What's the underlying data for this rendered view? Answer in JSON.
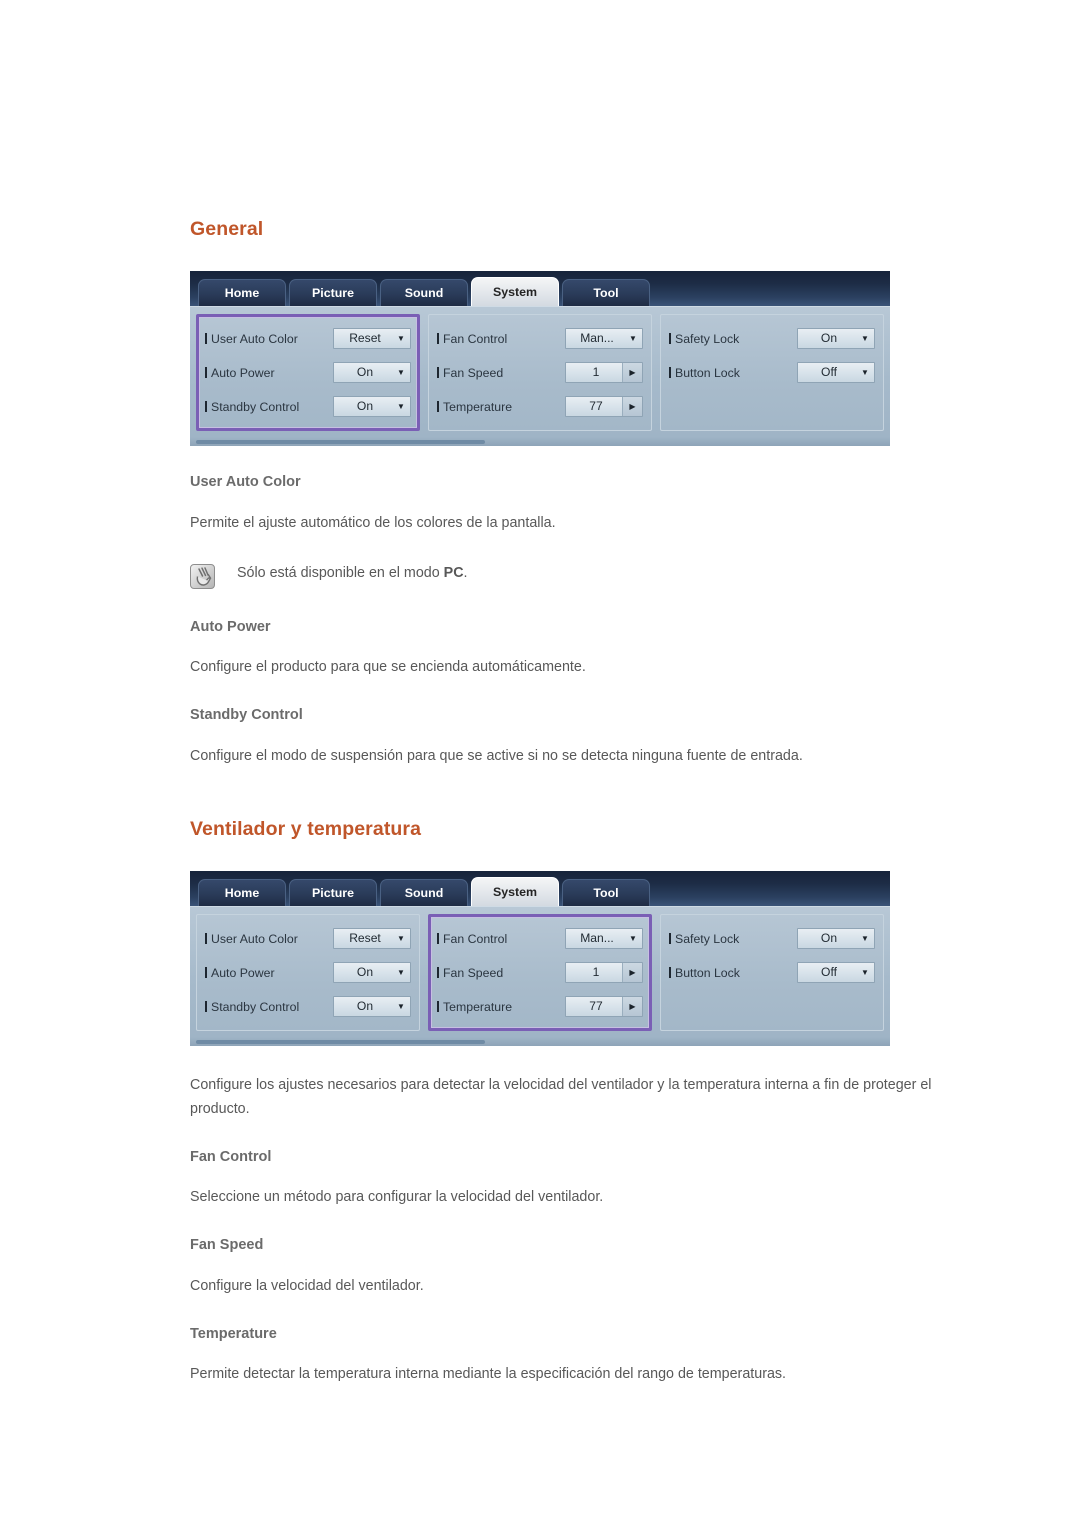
{
  "sections": [
    {
      "heading": "General",
      "osd": {
        "tabs": [
          "Home",
          "Picture",
          "Sound",
          "System",
          "Tool"
        ],
        "active_tab": "System",
        "highlight_column": 0,
        "highlight_color": "#7a5fb5",
        "columns": [
          {
            "rows": [
              {
                "label": "User Auto Color",
                "value": "Reset",
                "control": "dropdown"
              },
              {
                "label": "Auto Power",
                "value": "On",
                "control": "dropdown"
              },
              {
                "label": "Standby Control",
                "value": "On",
                "control": "dropdown"
              }
            ]
          },
          {
            "rows": [
              {
                "label": "Fan Control",
                "value": "Man...",
                "control": "dropdown"
              },
              {
                "label": "Fan Speed",
                "value": "1",
                "control": "stepper"
              },
              {
                "label": "Temperature",
                "value": "77",
                "control": "stepper"
              }
            ]
          },
          {
            "rows": [
              {
                "label": "Safety Lock",
                "value": "On",
                "control": "dropdown"
              },
              {
                "label": "Button Lock",
                "value": "Off",
                "control": "dropdown"
              }
            ]
          }
        ]
      },
      "items": [
        {
          "title": "User Auto Color",
          "text": "Permite el ajuste automático de los colores de la pantalla.",
          "note": {
            "text_before": "Sólo está disponible en el modo ",
            "bold": "PC",
            "text_after": "."
          }
        },
        {
          "title": "Auto Power",
          "text": "Configure el producto para que se encienda automáticamente."
        },
        {
          "title": "Standby Control",
          "text": "Configure el modo de suspensión para que se active si no se detecta ninguna fuente de entrada."
        }
      ]
    },
    {
      "heading": "Ventilador y temperatura",
      "osd": {
        "tabs": [
          "Home",
          "Picture",
          "Sound",
          "System",
          "Tool"
        ],
        "active_tab": "System",
        "highlight_column": 1,
        "highlight_color": "#7a5fb5",
        "columns": [
          {
            "rows": [
              {
                "label": "User Auto Color",
                "value": "Reset",
                "control": "dropdown"
              },
              {
                "label": "Auto Power",
                "value": "On",
                "control": "dropdown"
              },
              {
                "label": "Standby Control",
                "value": "On",
                "control": "dropdown"
              }
            ]
          },
          {
            "rows": [
              {
                "label": "Fan Control",
                "value": "Man...",
                "control": "dropdown"
              },
              {
                "label": "Fan Speed",
                "value": "1",
                "control": "stepper"
              },
              {
                "label": "Temperature",
                "value": "77",
                "control": "stepper"
              }
            ]
          },
          {
            "rows": [
              {
                "label": "Safety Lock",
                "value": "On",
                "control": "dropdown"
              },
              {
                "label": "Button Lock",
                "value": "Off",
                "control": "dropdown"
              }
            ]
          }
        ]
      },
      "intro": "Configure los ajustes necesarios para detectar la velocidad del ventilador y la temperatura interna a fin de proteger el producto.",
      "items": [
        {
          "title": "Fan Control",
          "text": "Seleccione un método para configurar la velocidad del ventilador."
        },
        {
          "title": "Fan Speed",
          "text": "Configure la velocidad del ventilador."
        },
        {
          "title": "Temperature",
          "text": "Permite detectar la temperatura interna mediante la especificación del rango de temperaturas."
        }
      ]
    }
  ],
  "glyphs": {
    "dropdown_caret": "▼",
    "stepper_arrow": "▶"
  },
  "colors": {
    "heading": "#c0562a",
    "highlight": "#7a5fb5"
  }
}
